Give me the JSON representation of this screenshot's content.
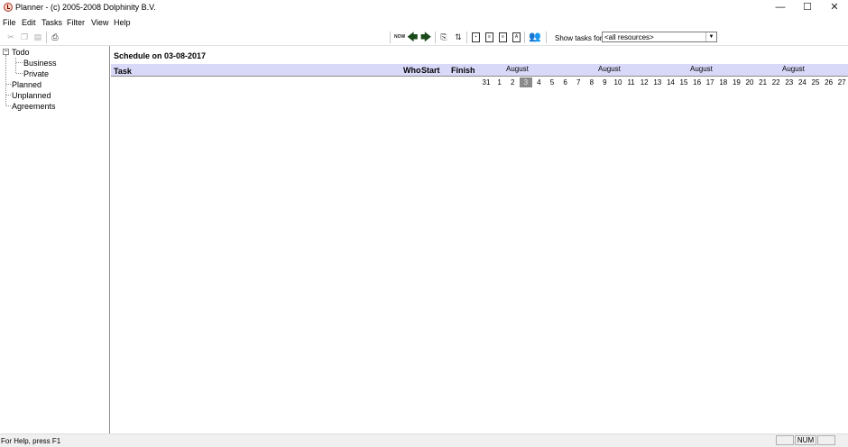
{
  "window": {
    "title": "Planner - (c) 2005-2008 Dolphinity B.V.",
    "controls": {
      "minimize": "—",
      "maximize": "☐",
      "close": "✕"
    }
  },
  "menu": [
    "File",
    "Edit",
    "Tasks",
    "Filter",
    "View",
    "Help"
  ],
  "toolbar": {
    "icons": [
      "cut-icon",
      "copy-icon",
      "paste-icon",
      "print-icon",
      "now-icon",
      "back-arrow-icon",
      "forward-arrow-icon",
      "new-task-icon",
      "sort-icon",
      "document-1-icon",
      "document-2-icon",
      "document-3-icon",
      "document-4-icon",
      "people-icon"
    ],
    "now_label": "NOW",
    "show_tasks_label": "Show tasks for",
    "resource_value": "<all resources>"
  },
  "tree": {
    "root": "Todo",
    "children": [
      "Business",
      "Private"
    ],
    "items": [
      "Planned",
      "Unplanned",
      "Agreements"
    ]
  },
  "schedule": {
    "title": "Schedule on 03-08-2017",
    "columns": {
      "task": "Task",
      "who": "Who",
      "start": "Start",
      "finish": "Finish"
    },
    "months": [
      "August",
      "August",
      "August",
      "August"
    ],
    "days": [
      "31",
      "1",
      "2",
      "3",
      "4",
      "5",
      "6",
      "7",
      "8",
      "9",
      "10",
      "11",
      "12",
      "13",
      "14",
      "15",
      "16",
      "17",
      "18",
      "19",
      "20",
      "21",
      "22",
      "23",
      "24",
      "25",
      "26",
      "27"
    ],
    "today": "3"
  },
  "status": {
    "text": "For Help, press F1",
    "num": "NUM"
  }
}
